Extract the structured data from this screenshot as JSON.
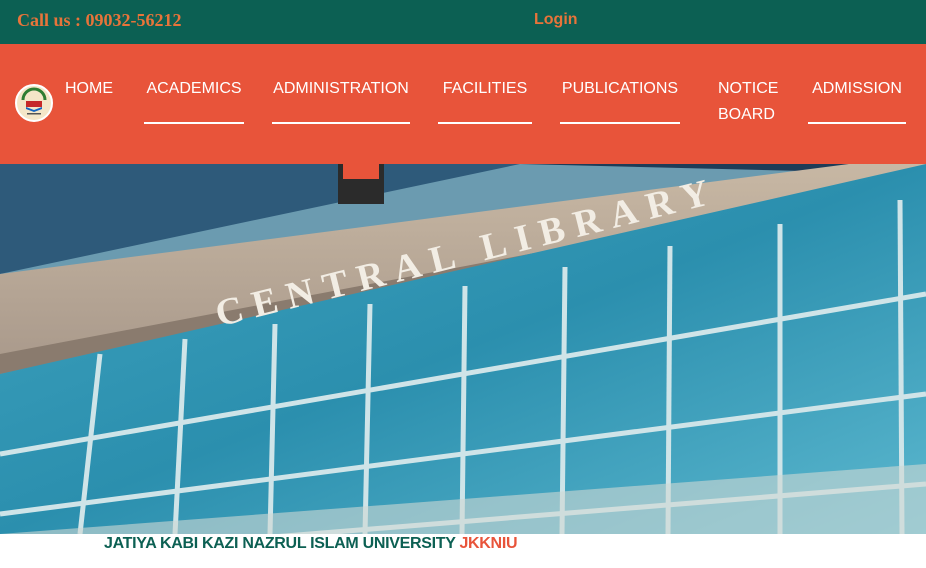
{
  "topbar": {
    "call": "Call us : 09032-56212",
    "login": "Login"
  },
  "nav": {
    "logo_icon": "university-logo-icon",
    "items": [
      {
        "label": "HOME"
      },
      {
        "label": "ACADEMICS"
      },
      {
        "label": "ADMINISTRATION"
      },
      {
        "label": "FACILITIES"
      },
      {
        "label": "PUBLICATIONS"
      },
      {
        "label": "NOTICE BOARD"
      },
      {
        "label": "ADMISSION"
      }
    ]
  },
  "hero": {
    "sign": "CENTRAL LIBRARY"
  },
  "footer": {
    "name": "JATIYA KABI KAZI NAZRUL ISLAM UNIVERSITY",
    "abbr": "JKKNIU"
  },
  "colors": {
    "topbar": "#0c6053",
    "navbar": "#e8543a",
    "accent": "#e8743a"
  }
}
